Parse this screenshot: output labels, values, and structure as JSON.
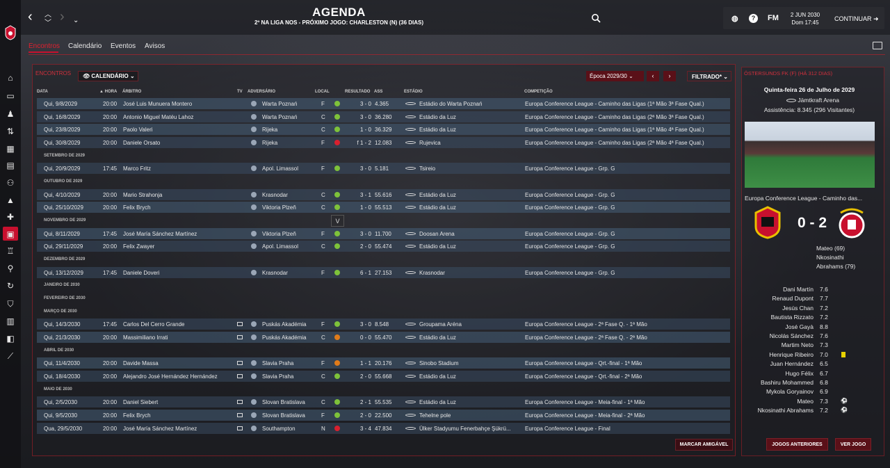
{
  "header": {
    "title": "AGENDA",
    "subtitle": "2º NA LIGA NOS - PRÓXIMO JOGO: CHARLESTON (N) (36 DIAS)",
    "fm_label": "FM",
    "date": "2 JUN 2030",
    "time": "Dom 17:45",
    "continue_label": "CONTINUAR"
  },
  "tabs": [
    "Encontros",
    "Calendário",
    "Eventos",
    "Avisos"
  ],
  "panel": {
    "title": "ENCONTROS",
    "view_label": "CALENDÁRIO",
    "season_label": "Época 2029/30",
    "filter_label": "FILTRADO*",
    "tooltip": "V",
    "friendly_button": "MARCAR AMIGÁVEL"
  },
  "columns": [
    "DATA",
    "HORA",
    "ÁRBITRO",
    "TV",
    "ADVERSÁRIO",
    "LOCAL",
    "RESULTADO",
    "ASS",
    "ESTÁDIO",
    "COMPETIÇÃO"
  ],
  "colors": {
    "accent": "#c8102e",
    "win": "#7ec23a",
    "draw": "#e07b1a",
    "loss": "#d8202e"
  },
  "rows": [
    {
      "type": "match",
      "date": "Qui, 9/8/2029",
      "time": "20:00",
      "referee": "José Luis Munuera Montero",
      "tv": false,
      "opponent": "Warta Poznań",
      "venue": "F",
      "outcome": "win",
      "result": "3 - 0",
      "att": "4.365",
      "stadium": "Estádio do Warta Poznań",
      "competition": "Europa Conference League - Caminho das Ligas (1ª Mão 3ª Fase Qual.)"
    },
    {
      "type": "match",
      "date": "Qui, 16/8/2029",
      "time": "20:00",
      "referee": "Antonio Miguel Matéu Lahoz",
      "tv": false,
      "opponent": "Warta Poznań",
      "venue": "C",
      "outcome": "win",
      "result": "3 - 0",
      "att": "36.280",
      "stadium": "Estádio da Luz",
      "competition": "Europa Conference League - Caminho das Ligas (2ª Mão 3ª Fase Qual.)"
    },
    {
      "type": "match",
      "date": "Qui, 23/8/2029",
      "time": "20:00",
      "referee": "Paolo Valeri",
      "tv": false,
      "opponent": "Rijeka",
      "venue": "C",
      "outcome": "win",
      "result": "1 - 0",
      "att": "36.329",
      "stadium": "Estádio da Luz",
      "competition": "Europa Conference League - Caminho das Ligas (1ª Mão 4ª Fase Qual.)"
    },
    {
      "type": "match",
      "date": "Qui, 30/8/2029",
      "time": "20:00",
      "referee": "Daniele Orsato",
      "tv": false,
      "opponent": "Rijeka",
      "venue": "F",
      "outcome": "loss",
      "result": "f 1 - 2",
      "att": "12.083",
      "stadium": "Rujevica",
      "competition": "Europa Conference League - Caminho das Ligas (2ª Mão 4ª Fase Qual.)"
    },
    {
      "type": "month",
      "label": "SETEMBRO DE 2029"
    },
    {
      "type": "match",
      "date": "Qui, 20/9/2029",
      "time": "17:45",
      "referee": "Marco Fritz",
      "tv": false,
      "opponent": "Apol. Limassol",
      "venue": "F",
      "outcome": "win",
      "result": "3 - 0",
      "att": "5.181",
      "stadium": "Tsireio",
      "competition": "Europa Conference League - Grp. G"
    },
    {
      "type": "month",
      "label": "OUTUBRO DE 2029"
    },
    {
      "type": "match",
      "date": "Qui, 4/10/2029",
      "time": "20:00",
      "referee": "Mario Strahonja",
      "tv": false,
      "opponent": "Krasnodar",
      "venue": "C",
      "outcome": "win",
      "result": "3 - 1",
      "att": "55.616",
      "stadium": "Estádio da Luz",
      "competition": "Europa Conference League - Grp. G"
    },
    {
      "type": "match",
      "date": "Qui, 25/10/2029",
      "time": "20:00",
      "referee": "Felix Brych",
      "tv": false,
      "opponent": "Viktoria Plzeň",
      "venue": "C",
      "outcome": "win",
      "result": "1 - 0",
      "att": "55.513",
      "stadium": "Estádio da Luz",
      "competition": "Europa Conference League - Grp. G"
    },
    {
      "type": "month",
      "label": "NOVEMBRO DE 2029"
    },
    {
      "type": "match",
      "date": "Qui, 8/11/2029",
      "time": "17:45",
      "referee": "José María Sánchez Martínez",
      "tv": false,
      "opponent": "Viktoria Plzeň",
      "venue": "F",
      "outcome": "win",
      "result": "3 - 0",
      "att": "11.700",
      "stadium": "Doosan Arena",
      "competition": "Europa Conference League - Grp. G"
    },
    {
      "type": "match",
      "date": "Qui, 29/11/2029",
      "time": "20:00",
      "referee": "Felix Zwayer",
      "tv": false,
      "opponent": "Apol. Limassol",
      "venue": "C",
      "outcome": "win",
      "result": "2 - 0",
      "att": "55.474",
      "stadium": "Estádio da Luz",
      "competition": "Europa Conference League - Grp. G"
    },
    {
      "type": "month",
      "label": "DEZEMBRO DE 2029"
    },
    {
      "type": "match",
      "date": "Qui, 13/12/2029",
      "time": "17:45",
      "referee": "Daniele Doveri",
      "tv": false,
      "opponent": "Krasnodar",
      "venue": "F",
      "outcome": "win",
      "result": "6 - 1",
      "att": "27.153",
      "stadium": "Krasnodar",
      "competition": "Europa Conference League - Grp. G"
    },
    {
      "type": "month",
      "label": "JANEIRO DE 2030"
    },
    {
      "type": "month",
      "label": "FEVEREIRO DE 2030"
    },
    {
      "type": "month",
      "label": "MARÇO DE 2030"
    },
    {
      "type": "match",
      "date": "Qui, 14/3/2030",
      "time": "17:45",
      "referee": "Carlos Del Cerro Grande",
      "tv": true,
      "opponent": "Puskás Akadémia",
      "venue": "F",
      "outcome": "win",
      "result": "3 - 0",
      "att": "8.548",
      "stadium": "Groupama Aréna",
      "competition": "Europa Conference League - 2ª Fase Q. - 1ª Mão"
    },
    {
      "type": "match",
      "date": "Qui, 21/3/2030",
      "time": "20:00",
      "referee": "Massimiliano Irrati",
      "tv": true,
      "opponent": "Puskás Akadémia",
      "venue": "C",
      "outcome": "draw",
      "result": "0 - 0",
      "att": "55.470",
      "stadium": "Estádio da Luz",
      "competition": "Europa Conference League - 2ª Fase Q. - 2ª Mão"
    },
    {
      "type": "month",
      "label": "ABRIL DE 2030"
    },
    {
      "type": "match",
      "date": "Qui, 11/4/2030",
      "time": "20:00",
      "referee": "Davide Massa",
      "tv": true,
      "opponent": "Slavia Praha",
      "venue": "F",
      "outcome": "draw",
      "result": "1 - 1",
      "att": "20.176",
      "stadium": "Sinobo Stadium",
      "competition": "Europa Conference League - Qrt.-final - 1ª Mão"
    },
    {
      "type": "match",
      "date": "Qui, 18/4/2030",
      "time": "20:00",
      "referee": "Alejandro José Hernández Hernández",
      "tv": true,
      "opponent": "Slavia Praha",
      "venue": "C",
      "outcome": "win",
      "result": "2 - 0",
      "att": "55.668",
      "stadium": "Estádio da Luz",
      "competition": "Europa Conference League - Qrt.-final - 2ª Mão"
    },
    {
      "type": "month",
      "label": "MAIO DE 2030"
    },
    {
      "type": "match",
      "date": "Qui, 2/5/2030",
      "time": "20:00",
      "referee": "Daniel Siebert",
      "tv": true,
      "opponent": "Slovan Bratislava",
      "venue": "C",
      "outcome": "win",
      "result": "2 - 1",
      "att": "55.535",
      "stadium": "Estádio da Luz",
      "competition": "Europa Conference League - Meia-final - 1ª Mão"
    },
    {
      "type": "match",
      "date": "Qui, 9/5/2030",
      "time": "20:00",
      "referee": "Felix Brych",
      "tv": true,
      "opponent": "Slovan Bratislava",
      "venue": "F",
      "outcome": "win",
      "result": "2 - 0",
      "att": "22.500",
      "stadium": "Tehelne pole",
      "competition": "Europa Conference League - Meia-final - 2ª Mão"
    },
    {
      "type": "match",
      "date": "Qua, 29/5/2030",
      "time": "20:00",
      "referee": "José María Sánchez Martínez",
      "tv": true,
      "opponent": "Southampton",
      "venue": "N",
      "outcome": "loss",
      "result": "3 - 4",
      "att": "47.834",
      "stadium": "Ülker Stadyumu Fenerbahçe Şükrü...",
      "competition": "Europa Conference League - Final"
    }
  ],
  "last_match": {
    "header": "ÖSTERSUNDS FK (F) (HÁ 312 DIAS)",
    "date": "Quinta-feira 26 de Julho de 2029",
    "stadium": "Jämtkraft Arena",
    "attendance": "Assistência: 8.345 (296 Visitantes)",
    "competition": "Europa Conference League - Caminho das...",
    "score": "0 - 2",
    "goals": [
      "Mateo (69)",
      "Nkosinathi",
      "Abrahams (79)"
    ],
    "players": [
      {
        "name": "Dani Martín",
        "rating": "7.6",
        "mark": ""
      },
      {
        "name": "Renaud Dupont",
        "rating": "7.7",
        "mark": ""
      },
      {
        "name": "Jesús Chan",
        "rating": "7.2",
        "mark": ""
      },
      {
        "name": "Bautista Rizzato",
        "rating": "7.2",
        "mark": ""
      },
      {
        "name": "José Gayà",
        "rating": "8.8",
        "mark": ""
      },
      {
        "name": "Nicolás Sánchez",
        "rating": "7.6",
        "mark": ""
      },
      {
        "name": "Martim Neto",
        "rating": "7.3",
        "mark": ""
      },
      {
        "name": "Henrique Ribeiro",
        "rating": "7.0",
        "mark": "yellow-card"
      },
      {
        "name": "Juan Hernández",
        "rating": "6.5",
        "mark": ""
      },
      {
        "name": "Hugo Félix",
        "rating": "6.7",
        "mark": ""
      },
      {
        "name": "Bashiru Mohammed",
        "rating": "6.8",
        "mark": ""
      },
      {
        "name": "Mykola Goryainov",
        "rating": "6.9",
        "mark": ""
      },
      {
        "name": "Mateo",
        "rating": "7.3",
        "mark": "goal"
      },
      {
        "name": "Nkosinathi Abrahams",
        "rating": "7.2",
        "mark": "goal"
      }
    ],
    "prev_button": "JOGOS ANTERIORES",
    "view_button": "VER JOGO"
  }
}
